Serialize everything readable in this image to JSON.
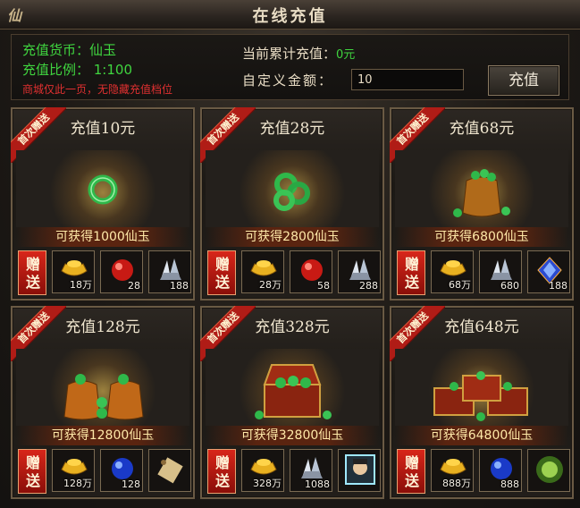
{
  "window": {
    "title": "在线充值",
    "logo": "仙"
  },
  "info": {
    "currency_line": "充值货币：仙玉",
    "ratio_line": "充值比例：  1:100",
    "note": "商城仅此一页，无隐藏充值档位",
    "cumulative_label": "当前累计充值：",
    "cumulative_value": "0元",
    "custom_label": "自定义金额：",
    "custom_value": "10",
    "pay_button": "充值"
  },
  "ribbon_text": "首次赠送",
  "gift_text": "赠送",
  "cards": [
    {
      "title": "充值10元",
      "gain": "可获得1000仙玉",
      "art": "jade-ring-icon",
      "rewards": [
        {
          "icon": "gold-ingot-icon",
          "count": "18万"
        },
        {
          "icon": "red-orb-icon",
          "count": "28"
        },
        {
          "icon": "crystal-shards-icon",
          "count": "188"
        }
      ]
    },
    {
      "title": "充值28元",
      "gain": "可获得2800仙玉",
      "art": "jade-rings-icon",
      "rewards": [
        {
          "icon": "gold-ingot-icon",
          "count": "28万"
        },
        {
          "icon": "red-orb-icon",
          "count": "58"
        },
        {
          "icon": "crystal-shards-icon",
          "count": "288"
        }
      ]
    },
    {
      "title": "充值68元",
      "gain": "可获得6800仙玉",
      "art": "jade-bag-icon",
      "rewards": [
        {
          "icon": "gold-ingot-icon",
          "count": "68万"
        },
        {
          "icon": "crystal-shards-icon",
          "count": "680"
        },
        {
          "icon": "blue-gem-icon",
          "count": "188"
        }
      ]
    },
    {
      "title": "充值128元",
      "gain": "可获得12800仙玉",
      "art": "jade-bags-icon",
      "rewards": [
        {
          "icon": "gold-ingot-icon",
          "count": "128万"
        },
        {
          "icon": "blue-orb-icon",
          "count": "128"
        },
        {
          "icon": "scroll-icon",
          "count": ""
        }
      ]
    },
    {
      "title": "充值328元",
      "gain": "可获得32800仙玉",
      "art": "treasure-chest-icon",
      "rewards": [
        {
          "icon": "gold-ingot-icon",
          "count": "328万"
        },
        {
          "icon": "crystal-shards-icon",
          "count": "1088"
        },
        {
          "icon": "character-portrait-icon",
          "count": ""
        }
      ]
    },
    {
      "title": "充值648元",
      "gain": "可获得64800仙玉",
      "art": "treasure-chests-icon",
      "rewards": [
        {
          "icon": "gold-ingot-icon",
          "count": "888万"
        },
        {
          "icon": "blue-orb-icon",
          "count": "888"
        },
        {
          "icon": "green-aura-icon",
          "count": ""
        }
      ]
    }
  ],
  "colors": {
    "accent_green": "#3fd43f",
    "warning_red": "#e03030",
    "gift_red": "#b01c16",
    "border": "#6a5a44"
  }
}
